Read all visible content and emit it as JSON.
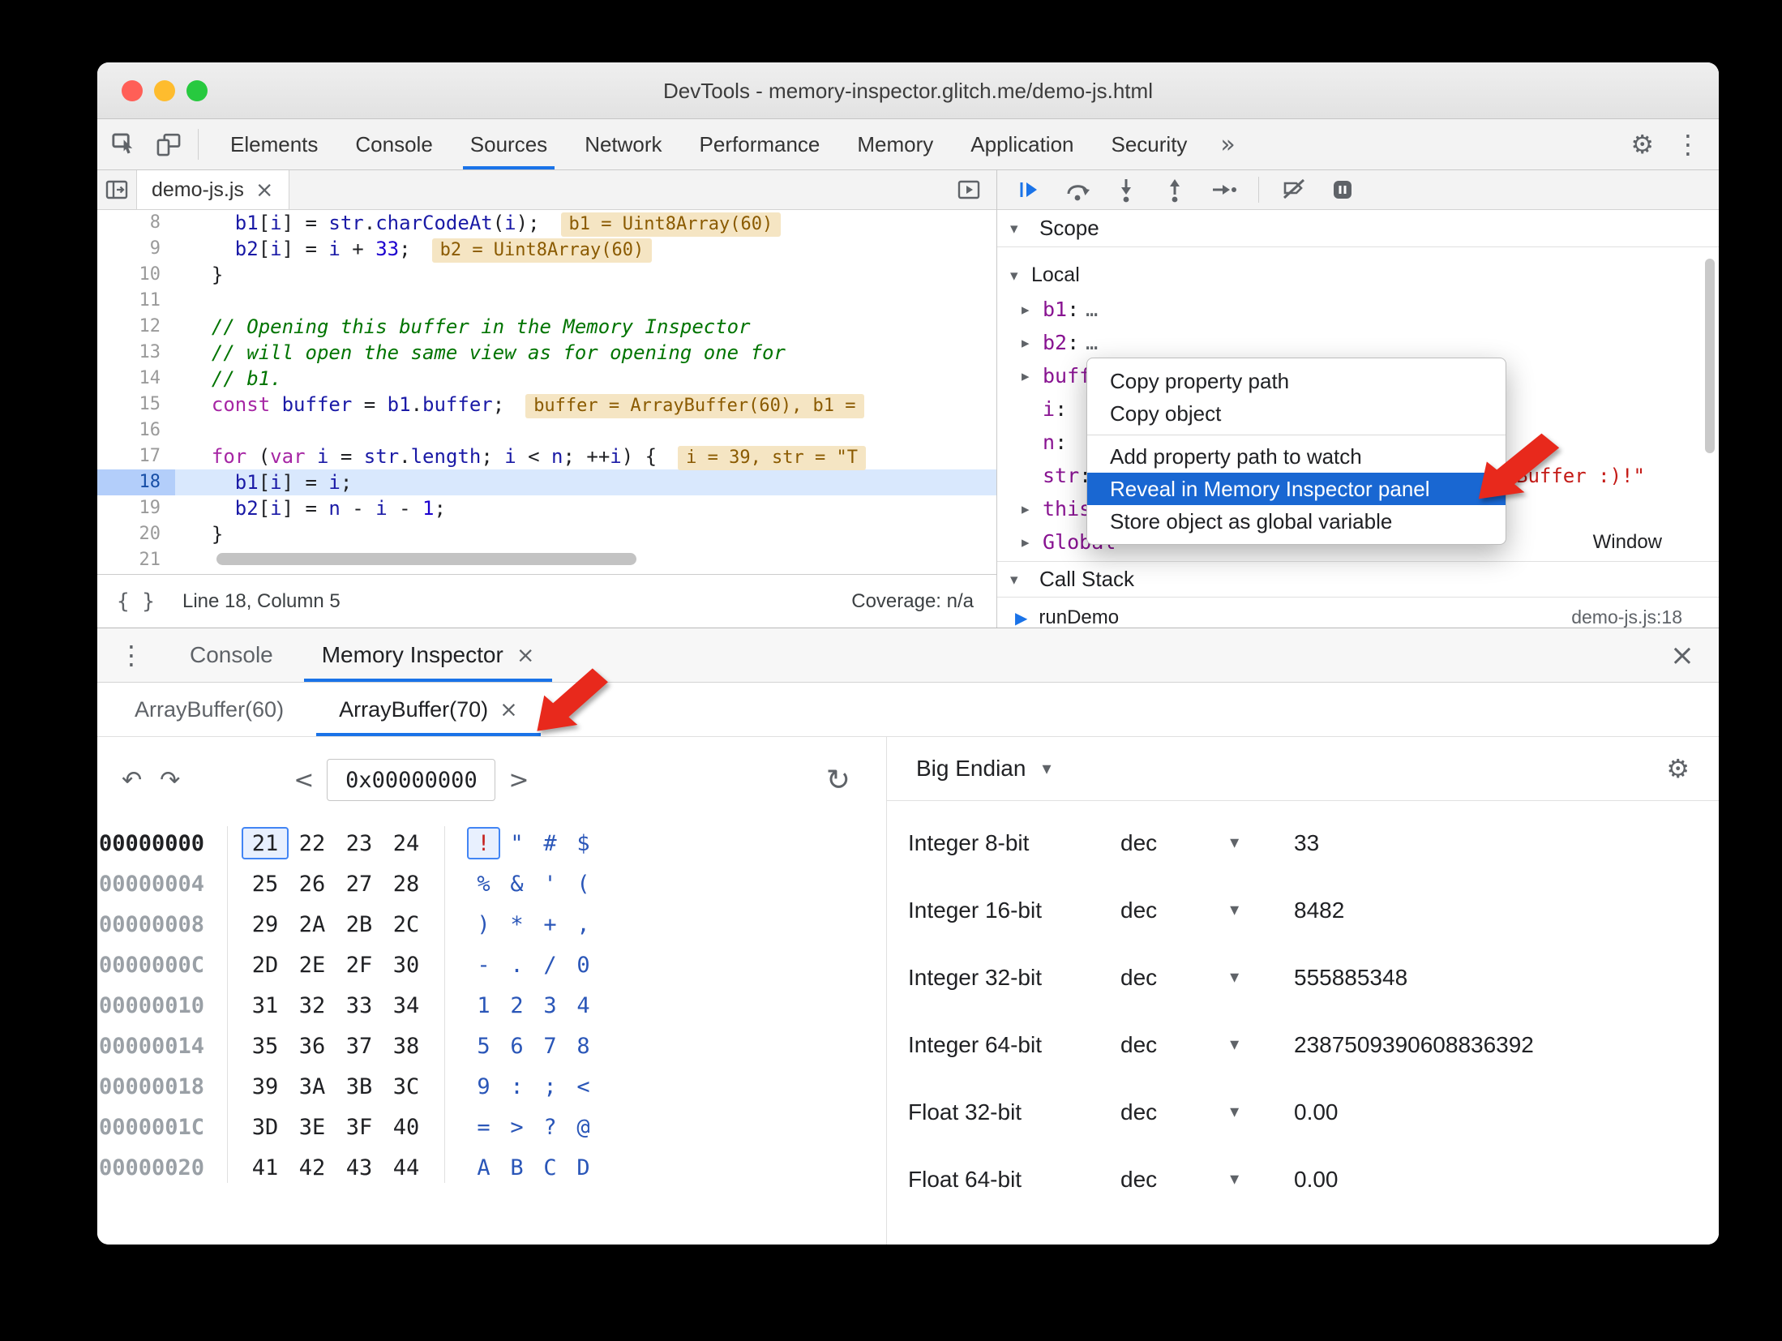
{
  "window": {
    "title": "DevTools - memory-inspector.glitch.me/demo-js.html"
  },
  "icons": {
    "overflow": "»",
    "menu_vertical": "⋮",
    "close": "×",
    "gear": "⚙",
    "caret_down": "▾",
    "twisty_open": "▾",
    "twisty_closed": "▸",
    "undo": "↶",
    "redo": "↷",
    "refresh": "↻",
    "chev_left": "<",
    "chev_right": ">",
    "braces": "{ }",
    "frame_marker": "▶"
  },
  "main_toolbar": {
    "tabs": [
      {
        "label": "Elements"
      },
      {
        "label": "Console"
      },
      {
        "label": "Sources",
        "active": true
      },
      {
        "label": "Network"
      },
      {
        "label": "Performance"
      },
      {
        "label": "Memory"
      },
      {
        "label": "Application"
      },
      {
        "label": "Security"
      }
    ],
    "overflow_label": "»"
  },
  "sources": {
    "file_tab": {
      "label": "demo-js.js"
    },
    "current_line": 18,
    "status": {
      "position": "Line 18, Column 5",
      "coverage": "Coverage: n/a"
    },
    "lines": [
      {
        "num": 8,
        "badge": "b1 = Uint8Array(60)",
        "code": [
          [
            "pn",
            "    "
          ],
          [
            "var",
            "b1"
          ],
          [
            "pn",
            "["
          ],
          [
            "var",
            "i"
          ],
          [
            "pn",
            "] = "
          ],
          [
            "var",
            "str"
          ],
          [
            "pn",
            "."
          ],
          [
            "var",
            "charCodeAt"
          ],
          [
            "pn",
            "("
          ],
          [
            "var",
            "i"
          ],
          [
            "pn",
            ");"
          ]
        ]
      },
      {
        "num": 9,
        "badge": "b2 = Uint8Array(60)",
        "code": [
          [
            "pn",
            "    "
          ],
          [
            "var",
            "b2"
          ],
          [
            "pn",
            "["
          ],
          [
            "var",
            "i"
          ],
          [
            "pn",
            "] = "
          ],
          [
            "var",
            "i"
          ],
          [
            "pn",
            " + "
          ],
          [
            "num",
            "33"
          ],
          [
            "pn",
            ";"
          ]
        ]
      },
      {
        "num": 10,
        "code": [
          [
            "pn",
            "  }"
          ]
        ]
      },
      {
        "num": 11,
        "code": []
      },
      {
        "num": 12,
        "code": [
          [
            "cm",
            "  // Opening this buffer in the Memory Inspector"
          ]
        ]
      },
      {
        "num": 13,
        "code": [
          [
            "cm",
            "  // will open the same view as for opening one for"
          ]
        ]
      },
      {
        "num": 14,
        "code": [
          [
            "cm",
            "  // b1."
          ]
        ]
      },
      {
        "num": 15,
        "badge": "buffer = ArrayBuffer(60), b1 =",
        "code": [
          [
            "pn",
            "  "
          ],
          [
            "kw",
            "const"
          ],
          [
            "pn",
            " "
          ],
          [
            "var",
            "buffer"
          ],
          [
            "pn",
            " = "
          ],
          [
            "var",
            "b1"
          ],
          [
            "pn",
            "."
          ],
          [
            "var",
            "buffer"
          ],
          [
            "pn",
            ";"
          ]
        ]
      },
      {
        "num": 16,
        "code": []
      },
      {
        "num": 17,
        "badge": "i = 39, str = \"T",
        "code": [
          [
            "pn",
            "  "
          ],
          [
            "kw",
            "for"
          ],
          [
            "pn",
            " ("
          ],
          [
            "kw",
            "var"
          ],
          [
            "pn",
            " "
          ],
          [
            "var",
            "i"
          ],
          [
            "pn",
            " = "
          ],
          [
            "var",
            "str"
          ],
          [
            "pn",
            "."
          ],
          [
            "var",
            "length"
          ],
          [
            "pn",
            "; "
          ],
          [
            "var",
            "i"
          ],
          [
            "pn",
            " < "
          ],
          [
            "var",
            "n"
          ],
          [
            "pn",
            "; ++"
          ],
          [
            "var",
            "i"
          ],
          [
            "pn",
            ") {"
          ]
        ]
      },
      {
        "num": 18,
        "code": [
          [
            "pn",
            "    "
          ],
          [
            "var",
            "b1"
          ],
          [
            "pn",
            "["
          ],
          [
            "var",
            "i"
          ],
          [
            "pn",
            "] = "
          ],
          [
            "var",
            "i"
          ],
          [
            "pn",
            ";"
          ]
        ]
      },
      {
        "num": 19,
        "code": [
          [
            "pn",
            "    "
          ],
          [
            "var",
            "b2"
          ],
          [
            "pn",
            "["
          ],
          [
            "var",
            "i"
          ],
          [
            "pn",
            "] = "
          ],
          [
            "var",
            "n"
          ],
          [
            "pn",
            " - "
          ],
          [
            "var",
            "i"
          ],
          [
            "pn",
            " - "
          ],
          [
            "num",
            "1"
          ],
          [
            "pn",
            ";"
          ]
        ]
      },
      {
        "num": 20,
        "code": [
          [
            "pn",
            "  }"
          ]
        ]
      },
      {
        "num": 21,
        "code": []
      }
    ]
  },
  "debugger": {
    "scope_title": "Scope",
    "local_label": "Local",
    "variables": [
      {
        "name": "b1",
        "value": "…",
        "expandable": true
      },
      {
        "name": "b2",
        "value": "…",
        "expandable": true
      },
      {
        "name": "buffer",
        "expandable": true
      },
      {
        "name": "i"
      },
      {
        "name": "n"
      },
      {
        "name": "str"
      },
      {
        "name": "this",
        "expandable": true
      }
    ],
    "str_overflow_fragment": "Buffer :)!\"",
    "global_row": {
      "name": "Global",
      "value": "Window"
    },
    "call_stack_title": "Call Stack",
    "frames": [
      {
        "name": "runDemo",
        "location": "demo-js.js:18"
      }
    ]
  },
  "context_menu": {
    "items": [
      {
        "label": "Copy property path"
      },
      {
        "label": "Copy object"
      },
      {
        "separator": true
      },
      {
        "label": "Add property path to watch"
      },
      {
        "label": "Reveal in Memory Inspector panel",
        "highlighted": true
      },
      {
        "label": "Store object as global variable"
      }
    ]
  },
  "drawer": {
    "tabs": [
      {
        "label": "Console"
      },
      {
        "label": "Memory Inspector",
        "active": true,
        "close": "×"
      }
    ]
  },
  "memory_inspector": {
    "buffer_tabs": [
      {
        "label": "ArrayBuffer(60)"
      },
      {
        "label": "ArrayBuffer(70)",
        "active": true,
        "close": "×"
      }
    ],
    "address": "0x00000000",
    "endianness": "Big Endian",
    "selection": {
      "row": 0,
      "col": 0
    },
    "hex_rows": [
      {
        "addr": "00000000",
        "bytes": [
          "21",
          "22",
          "23",
          "24"
        ],
        "ascii": [
          "!",
          "\"",
          "#",
          "$"
        ]
      },
      {
        "addr": "00000004",
        "bytes": [
          "25",
          "26",
          "27",
          "28"
        ],
        "ascii": [
          "%",
          "&",
          "'",
          "("
        ]
      },
      {
        "addr": "00000008",
        "bytes": [
          "29",
          "2A",
          "2B",
          "2C"
        ],
        "ascii": [
          ")",
          "*",
          "+",
          ","
        ]
      },
      {
        "addr": "0000000C",
        "bytes": [
          "2D",
          "2E",
          "2F",
          "30"
        ],
        "ascii": [
          "-",
          ".",
          "/",
          "0"
        ]
      },
      {
        "addr": "00000010",
        "bytes": [
          "31",
          "32",
          "33",
          "34"
        ],
        "ascii": [
          "1",
          "2",
          "3",
          "4"
        ]
      },
      {
        "addr": "00000014",
        "bytes": [
          "35",
          "36",
          "37",
          "38"
        ],
        "ascii": [
          "5",
          "6",
          "7",
          "8"
        ]
      },
      {
        "addr": "00000018",
        "bytes": [
          "39",
          "3A",
          "3B",
          "3C"
        ],
        "ascii": [
          "9",
          ":",
          ";",
          "<"
        ]
      },
      {
        "addr": "0000001C",
        "bytes": [
          "3D",
          "3E",
          "3F",
          "40"
        ],
        "ascii": [
          "=",
          ">",
          "?",
          "@"
        ]
      },
      {
        "addr": "00000020",
        "bytes": [
          "41",
          "42",
          "43",
          "44"
        ],
        "ascii": [
          "A",
          "B",
          "C",
          "D"
        ]
      }
    ],
    "value_rows": [
      {
        "label": "Integer 8-bit",
        "format": "dec",
        "value": "33"
      },
      {
        "label": "Integer 16-bit",
        "format": "dec",
        "value": "8482"
      },
      {
        "label": "Integer 32-bit",
        "format": "dec",
        "value": "555885348"
      },
      {
        "label": "Integer 64-bit",
        "format": "dec",
        "value": "2387509390608836392"
      },
      {
        "label": "Float 32-bit",
        "format": "dec",
        "value": "0.00"
      },
      {
        "label": "Float 64-bit",
        "format": "dec",
        "value": "0.00"
      }
    ]
  }
}
